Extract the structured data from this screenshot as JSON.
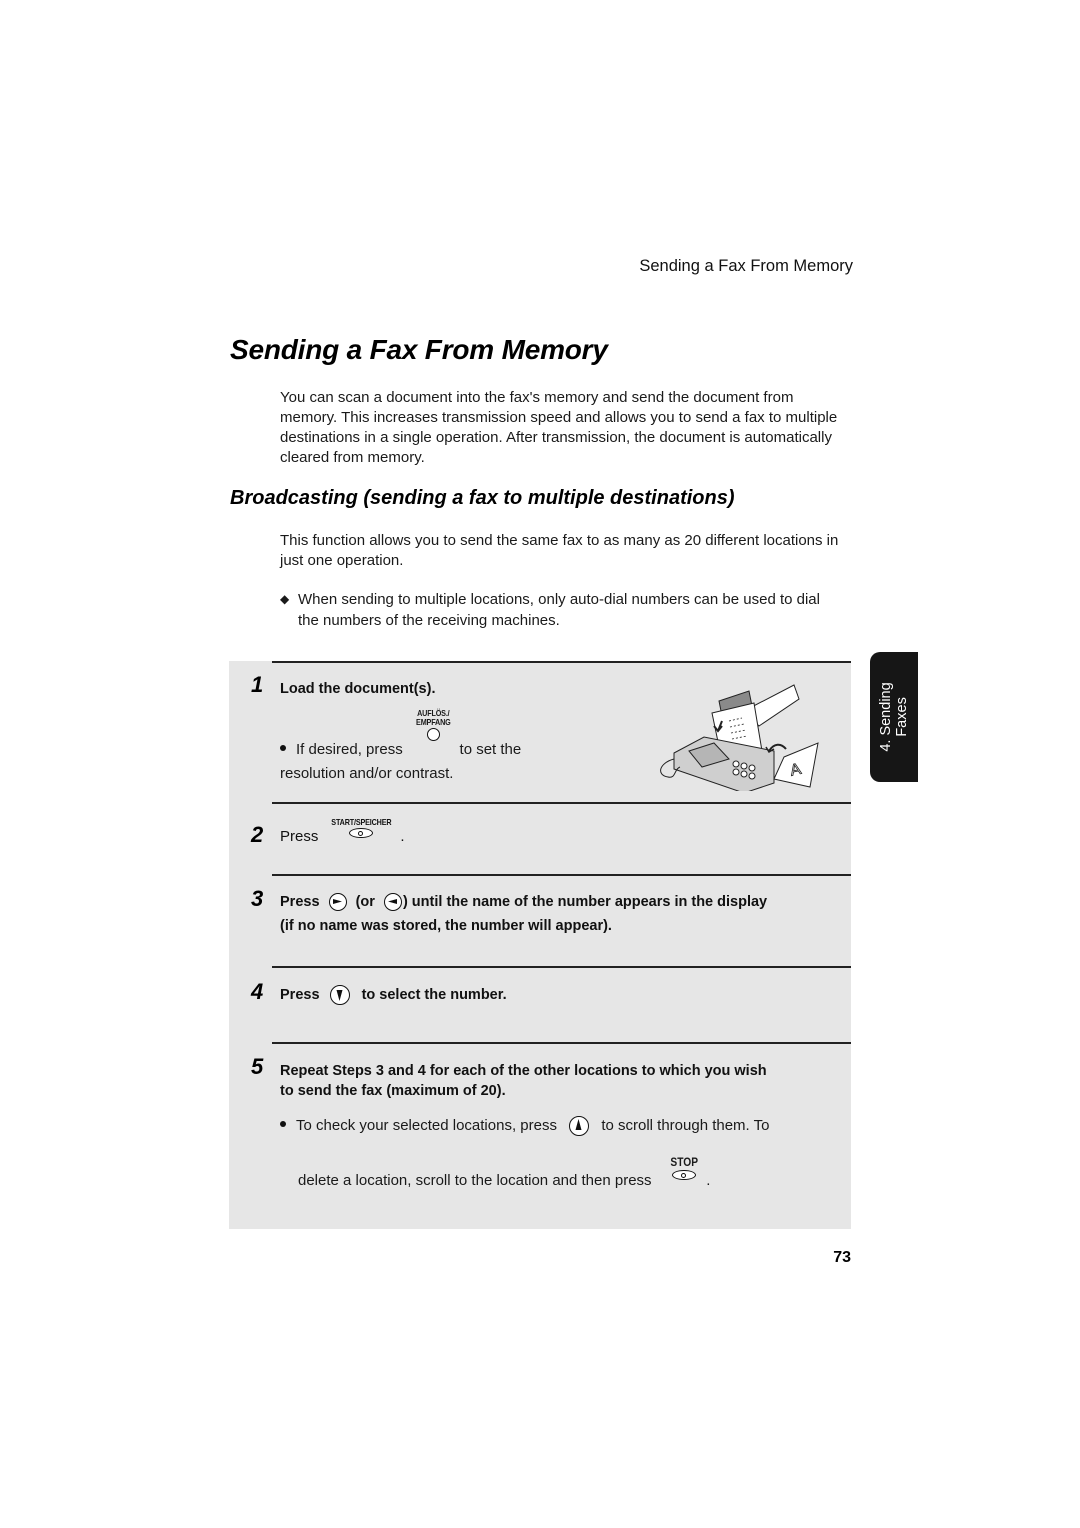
{
  "running_header": "Sending a Fax From Memory",
  "page_title": "Sending a Fax From Memory",
  "intro_paragraph": "You can scan a document into the fax's memory and send the document from memory. This increases transmission speed and allows you to send a fax to multiple destinations in a single operation. After transmission, the document is automatically cleared from memory.",
  "section": {
    "title": "Broadcasting (sending a fax to multiple destinations)",
    "paragraph": "This function allows you to send the same fax to as many as 20 different locations in just one operation.",
    "bullet": "When sending to multiple locations, only auto-dial numbers can be used to dial the numbers of the receiving machines."
  },
  "steps": [
    {
      "number": "1",
      "text": "Load the document(s).",
      "sub_pre": "If desired, press",
      "key_label_line1": "AUFLÖS./",
      "key_label_line2": "EMPFANG",
      "sub_post": "to set the",
      "sub_line2": "resolution and/or contrast.",
      "illustration": "fax-machine-loading-document"
    },
    {
      "number": "2",
      "pre": "Press",
      "key_label": "START/SPEICHER",
      "post": "."
    },
    {
      "number": "3",
      "pre": "Press",
      "mid": "(or",
      "post": ") until the name of the number appears in the display",
      "line2": "(if no name was stored, the number will appear).",
      "icons": [
        "right-arrow-key",
        "left-arrow-key"
      ]
    },
    {
      "number": "4",
      "pre": "Press",
      "post": "to select the number.",
      "icon": "down-arrow-key"
    },
    {
      "number": "5",
      "text_line1": "Repeat Steps 3 and 4 for each of the other locations to which you wish",
      "text_line2": "to send the fax (maximum of 20).",
      "sub_pre": "To check your selected locations, press",
      "sub_post": "to scroll through them. To",
      "sub_line2": "delete a location, scroll to the location and then press",
      "stop_label": "STOP",
      "sub_end": ".",
      "icon": "up-arrow-key"
    }
  ],
  "side_tab": {
    "line1": "4. Sending",
    "line2": "Faxes"
  },
  "page_number": "73"
}
